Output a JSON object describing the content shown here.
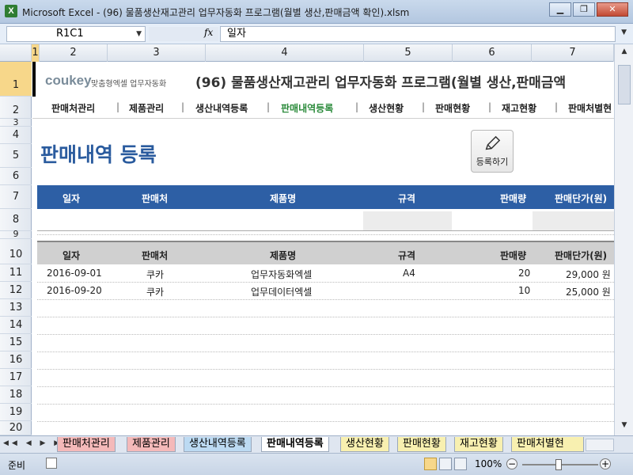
{
  "window": {
    "title": "Microsoft Excel - (96) 물품생산재고관리 업무자동화 프로그램(월별 생산,판매금액 확인).xlsm",
    "app_icon": "X"
  },
  "formula_bar": {
    "name_box": "R1C1",
    "fx": "fx",
    "value": "일자"
  },
  "columns": [
    "1",
    "2",
    "3",
    "4",
    "5",
    "6",
    "7"
  ],
  "rows": [
    "1",
    "2",
    "3",
    "4",
    "5",
    "6",
    "7",
    "8",
    "9",
    "10",
    "11",
    "12",
    "13",
    "14",
    "15",
    "16",
    "17",
    "18",
    "19",
    "20"
  ],
  "header": {
    "brand": "coukey",
    "brand_sub": "맞춤형엑셀 업무자동화",
    "title": "(96) 물품생산재고관리 업무자동화 프로그램(월별 생산,판매금액"
  },
  "nav": [
    {
      "label": "판매처관리",
      "active": false
    },
    {
      "label": "제품관리",
      "active": false
    },
    {
      "label": "생산내역등록",
      "active": false
    },
    {
      "label": "판매내역등록",
      "active": true
    },
    {
      "label": "생산현황",
      "active": false
    },
    {
      "label": "판매현황",
      "active": false
    },
    {
      "label": "재고현황",
      "active": false
    },
    {
      "label": "판매처별현",
      "active": false
    }
  ],
  "page_title": "판매내역 등록",
  "register_button": "등록하기",
  "table_headers": [
    "일자",
    "판매처",
    "제품명",
    "규격",
    "판매량",
    "판매단가(원)"
  ],
  "records": [
    {
      "date": "2016-09-01",
      "vendor": "쿠카",
      "product": "업무자동화엑셀",
      "spec": "A4",
      "qty": "20",
      "price": "29,000 원"
    },
    {
      "date": "2016-09-20",
      "vendor": "쿠카",
      "product": "업무데이터엑셀",
      "spec": "",
      "qty": "10",
      "price": "25,000 원"
    }
  ],
  "sheet_tabs": [
    {
      "label": "판매처관리",
      "color": "#f4b9b9"
    },
    {
      "label": "제품관리",
      "color": "#f4b9b9"
    },
    {
      "label": "생산내역등록",
      "color": "#bcdaf2"
    },
    {
      "label": "판매내역등록",
      "color": "#ffffff"
    },
    {
      "label": "생산현황",
      "color": "#f8f0b0"
    },
    {
      "label": "판매현황",
      "color": "#f8f0b0"
    },
    {
      "label": "재고현황",
      "color": "#f8f0b0"
    },
    {
      "label": "판매처별현",
      "color": "#f8f0b0"
    }
  ],
  "status": {
    "mode": "준비",
    "zoom": "100%"
  }
}
